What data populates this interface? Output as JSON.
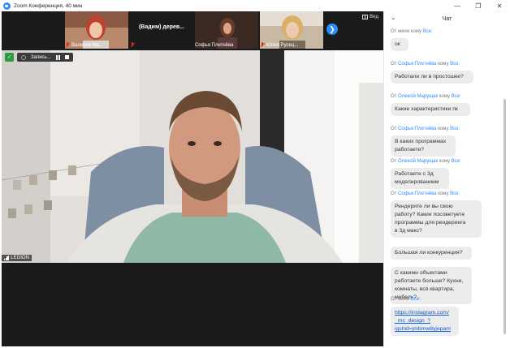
{
  "window": {
    "title": "Zoom Конференция, 40 мин",
    "controls": [
      "—",
      "❐",
      "✕"
    ]
  },
  "strip": {
    "participants": [
      {
        "name": "Валерия Ма..."
      },
      {
        "name": "(Вадим) дерев..."
      },
      {
        "name": "Софья Плетнёва"
      },
      {
        "name": "Юлия Русец..."
      }
    ],
    "view_label": "Вид",
    "next_arrow": "❯"
  },
  "meeting": {
    "recording_label": "Запись...",
    "speaker_name": "LEGION"
  },
  "chat": {
    "title": "Чат",
    "collapse_glyph": "⌄",
    "messages": [
      {
        "meta_from": "От",
        "sender": "меня",
        "meta_to": "кому",
        "recipient": "Все:",
        "lines": [
          "ок"
        ]
      },
      {
        "meta_from": "От",
        "sender": "Софья Плетнёва",
        "meta_to": "кому",
        "recipient": "Все:",
        "lines": [
          "Работали ли в простошке?"
        ]
      },
      {
        "meta_from": "От",
        "sender": "Олексій Марущак",
        "meta_to": "кому",
        "recipient": "Все:",
        "lines": [
          "Какие характеристики пк"
        ]
      },
      {
        "meta_from": "От",
        "sender": "Софья Плетнёва",
        "meta_to": "кому",
        "recipient": "Все:",
        "lines": [
          "В каких программах",
          "работаете?"
        ]
      },
      {
        "meta_from": "От",
        "sender": "Олексій Марущак",
        "meta_to": "кому",
        "recipient": "Все:",
        "lines": [
          "Работаете с 3д",
          "моделированием"
        ]
      },
      {
        "meta_from": "От",
        "sender": "Софья Плетнёва",
        "meta_to": "кому",
        "recipient": "Все:",
        "lines": [
          "Рендерите ли вы свою",
          "работу? Какие посоветуете",
          "программы для рендеринга",
          "в 3д макс?"
        ]
      },
      {
        "lines": [
          "Большая ли конкуренция?"
        ]
      },
      {
        "lines": [
          "С какими объектами",
          "работаете больше? Кухни,",
          "комнаты, вся квартира,",
          "мебель?"
        ]
      },
      {
        "meta_from": "От",
        "sender": "меня",
        "meta_to": "",
        "recipient": "Все:",
        "lines": [
          "https://instagram.com/",
          "_mc_design_?",
          "igshid=jmbmw8yjepam"
        ],
        "is_link": true
      }
    ]
  },
  "colors": {
    "accent": "#2d8cff",
    "chat_bubble": "#ececec",
    "recording_shield": "#2c9a3e",
    "muted_mic": "#e02828"
  }
}
